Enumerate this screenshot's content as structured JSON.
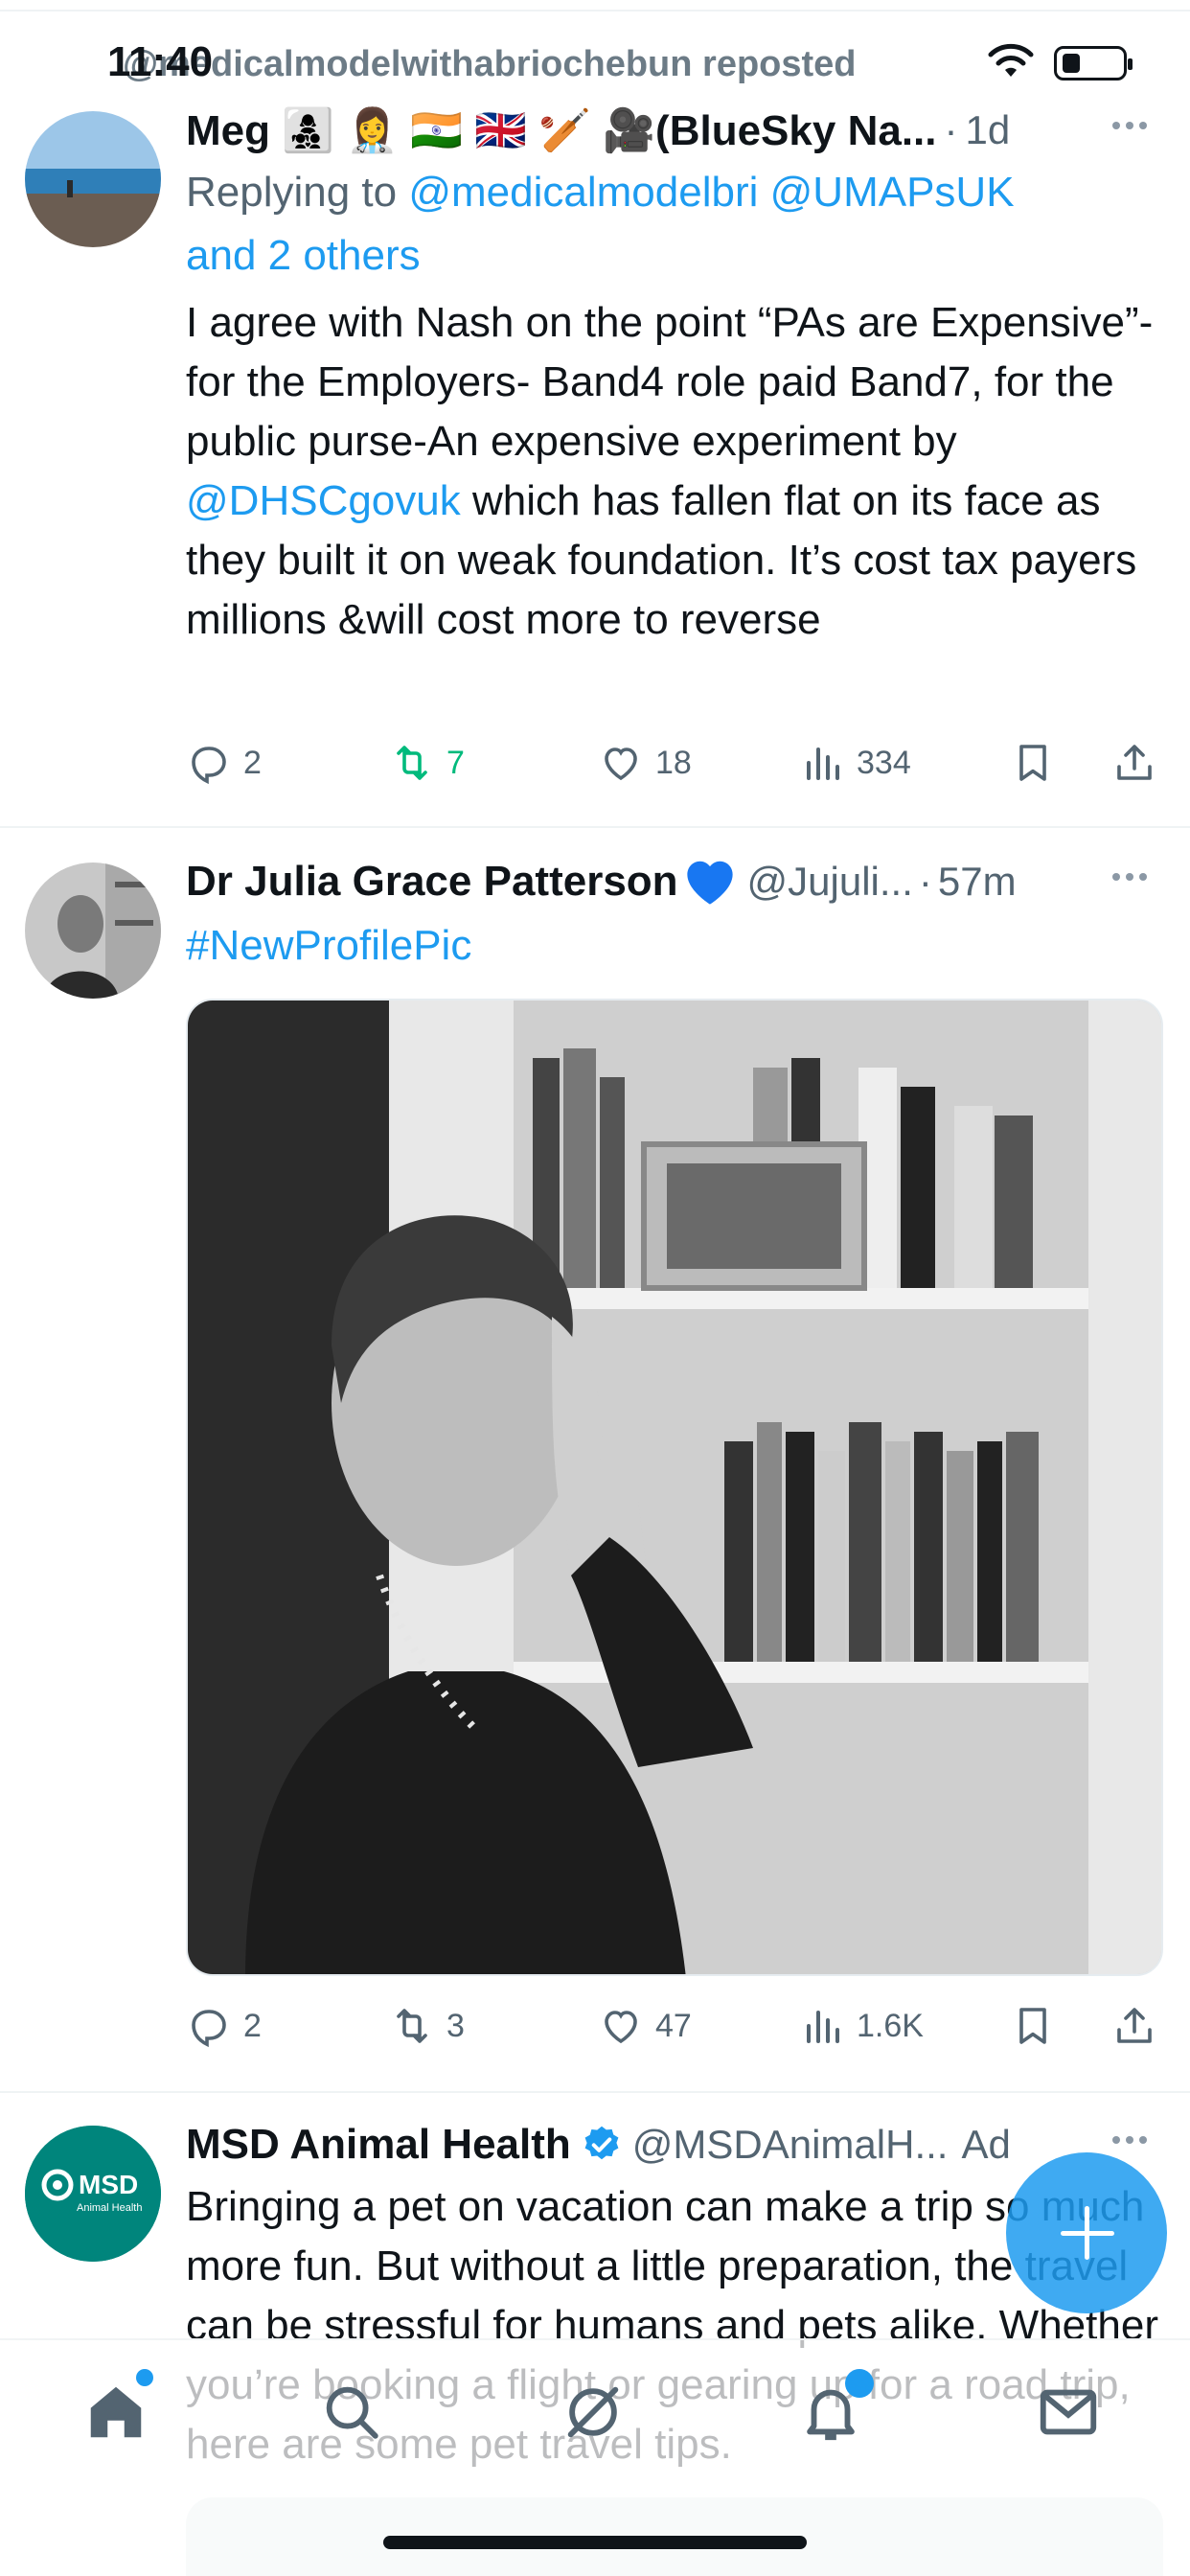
{
  "status_bar": {
    "time": "11:40",
    "repost_text": "@medicalmodelwithabriochebun reposted"
  },
  "tweets": [
    {
      "name": "Meg 👩‍👧‍👦 👩‍⚕️ 🇮🇳 🇬🇧 🏏 🎥(BlueSky Na...",
      "dot": "·",
      "time": "1d",
      "reply_prefix": "Replying to ",
      "reply_mention_1": "@medicalmodelbri",
      "reply_mention_2": "@UMAPsUK",
      "reply_others": "and 2 others",
      "text_1": "I agree with Nash on the point “PAs are Expensive”-for the Employers- Band4 role paid Band7, for the public purse-An expensive experiment by ",
      "text_mention": "@DHSCgovuk",
      "text_2": " which has fallen flat on its face as they built it on weak foundation. It’s cost tax payers millions &will cost more to reverse",
      "replies": "2",
      "reposts": "7",
      "likes": "18",
      "views": "334"
    },
    {
      "name": "Dr Julia Grace Patterson",
      "handle": "@Jujuli...",
      "dot": "·",
      "time": "57m",
      "hashtag": "#NewProfilePic",
      "replies": "2",
      "reposts": "3",
      "likes": "47",
      "views": "1.6K"
    },
    {
      "name": "MSD Animal Health",
      "handle": "@MSDAnimalH...",
      "ad_label": "Ad",
      "avatar_text": "MSD",
      "avatar_subtext": "Animal Health",
      "text": "Bringing a pet on vacation can make a trip so much more fun. But without a little preparation, the travel can be stressful for humans and pets alike. Whether you’re booking a flight or gearing up for a road trip, here are some pet travel tips."
    }
  ],
  "colors": {
    "accent": "#1d9bf0",
    "repost_green": "#00ba7c",
    "text_primary": "#0f1419",
    "text_secondary": "#536471",
    "msd_teal": "#00857c"
  },
  "icons": [
    "reply-icon",
    "repost-icon",
    "like-icon",
    "views-icon",
    "bookmark-icon",
    "share-icon",
    "more-icon",
    "verified-icon",
    "heart-emoji-icon",
    "home-icon",
    "search-icon",
    "grok-icon",
    "notifications-icon",
    "messages-icon",
    "compose-icon"
  ]
}
